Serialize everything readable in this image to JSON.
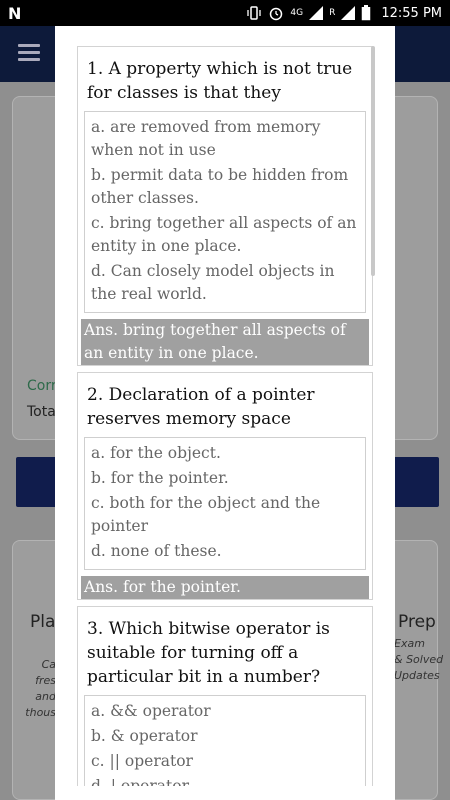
{
  "status_bar": {
    "logo": "N",
    "network": "4G",
    "roaming": "R",
    "time": "12:55 PM",
    "icons": [
      "vibrate-icon",
      "alarm-icon",
      "signal-icon",
      "battery-icon"
    ]
  },
  "background": {
    "corr_text": "Corr",
    "tota_text": "Tota",
    "pla_text": "Pla",
    "prep_text": "Prep",
    "left_lines": [
      "Ca",
      "fres",
      "and",
      "thous"
    ],
    "right_lines": [
      "Exam",
      "& Solved",
      "Updates"
    ]
  },
  "questions": [
    {
      "title": "1. A property which is not true for classes is that they",
      "options": [
        "a. are removed from memory when not in use",
        "b. permit data to be hidden from other classes.",
        "c. bring together all aspects of an entity in one place.",
        "d. Can closely model objects in the real world."
      ],
      "answer": "Ans. bring together all aspects of an entity in one place."
    },
    {
      "title": "2. Declaration of a pointer reserves memory space",
      "options": [
        "a. for the object.",
        "b. for the pointer.",
        "c. both for the object and the pointer",
        "d. none of these."
      ],
      "answer": "Ans. for the pointer."
    },
    {
      "title": "3. Which bitwise operator is suitable for turning off a particular bit in a number?",
      "options": [
        "a. && operator",
        "b. & operator",
        "c. || operator",
        "d. | operator"
      ],
      "answer": ""
    }
  ]
}
